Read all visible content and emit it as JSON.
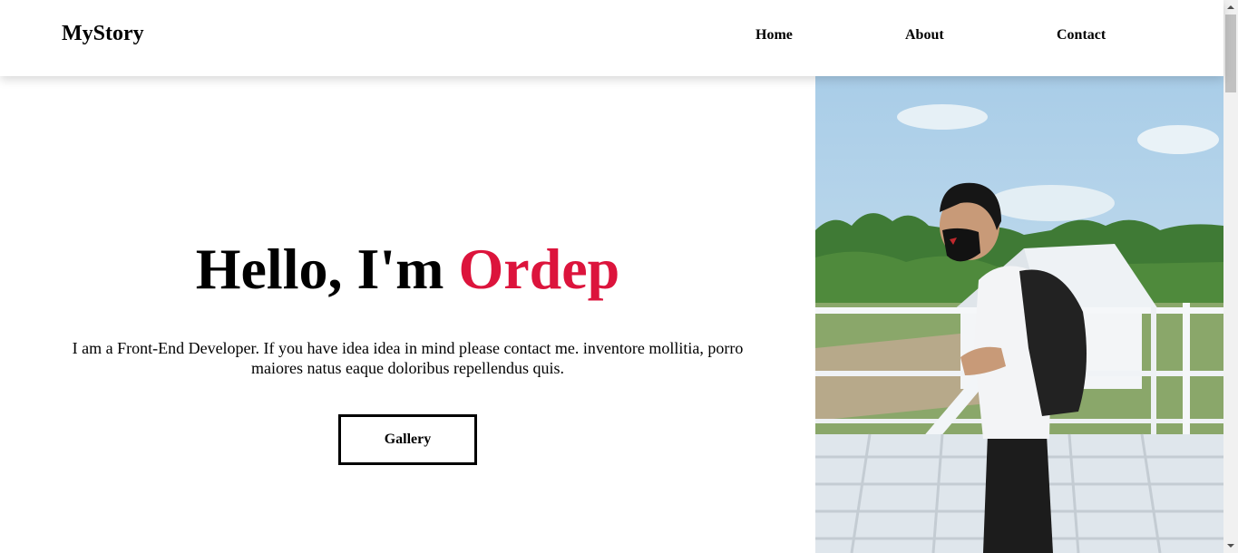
{
  "navbar": {
    "brand": "MyStory",
    "links": [
      {
        "label": "Home"
      },
      {
        "label": "About"
      },
      {
        "label": "Contact"
      }
    ]
  },
  "hero": {
    "greeting": "Hello, I'm ",
    "name": "Ordep",
    "description": "I am a Front-End Developer. If you have idea idea in mind please contact me. inventore mollitia, porro maiores natus eaque doloribus repellendus quis.",
    "button_label": "Gallery",
    "accent_color": "#dc143c"
  },
  "photo": {
    "subject": "person-on-balcony-photo"
  }
}
